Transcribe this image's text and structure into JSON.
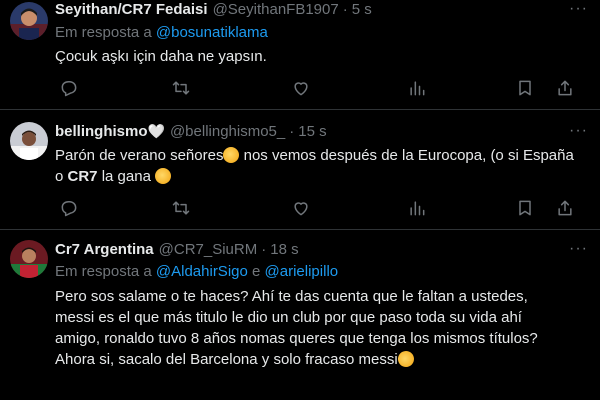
{
  "tweets": [
    {
      "name": "Seyithan/CR7 Fedaisi",
      "handle": "@SeyithanFB1907",
      "dot": "·",
      "time": "5 s",
      "reply_prefix": "Em resposta a",
      "reply_to": "@bosunatiklama",
      "text": "Çocuk aşkı için daha ne yapsın."
    },
    {
      "name": "bellinghismo",
      "heart_emoji": "🤍",
      "handle": "@bellinghismo5_",
      "dot": "·",
      "time": "15 s",
      "text_part1": "Parón de verano señores",
      "emoji1": "saluting-face",
      "text_part2": " nos vemos después de la Eurocopa, (o si España o ",
      "text_bold": "CR7",
      "text_part3": " la gana ",
      "emoji2": "relieved-face"
    },
    {
      "name": "Cr7 Argentina",
      "handle": "@CR7_SiuRM",
      "dot": "·",
      "time": "18 s",
      "reply_prefix": "Em resposta a",
      "reply_to_1": "@AldahirSigo",
      "reply_conj": "e",
      "reply_to_2": "@arielipillo",
      "text": "Pero sos salame o te haces? Ahí te das cuenta que le faltan a ustedes, messi es el que más titulo le dio un club por que paso toda su vida ahí amigo, ronaldo tuvo 8 años nomas queres que tenga los mismos títulos? Ahora si, sacalo del Barcelona y solo fracaso messi",
      "emoji_end": "rolling-on-the-floor-laughing"
    }
  ],
  "more_label": "···",
  "actions": [
    "reply-icon",
    "retweet-icon",
    "like-icon",
    "views-icon",
    "bookmark-icon",
    "share-icon"
  ],
  "colors": {
    "background": "#000000",
    "text": "#e7e9ea",
    "muted": "#71767b",
    "link": "#1d9bf0",
    "divider": "#2f3336"
  }
}
